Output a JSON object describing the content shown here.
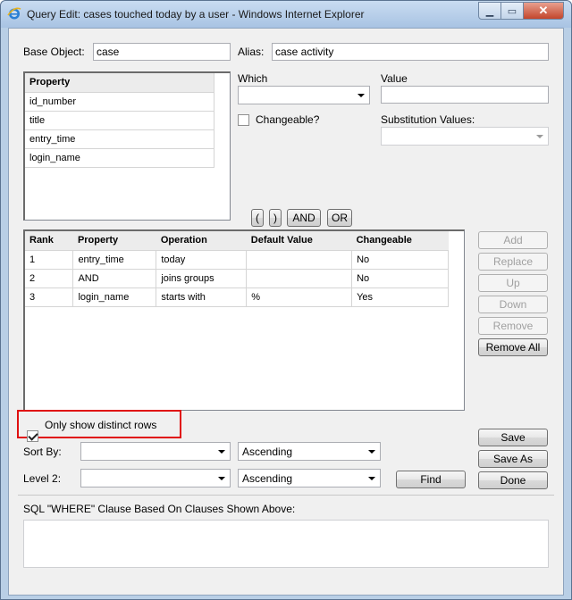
{
  "window": {
    "title": "Query Edit: cases touched today by a user - Windows Internet Explorer",
    "min_glyph": "▁",
    "max_glyph": "▭",
    "close_glyph": "✕"
  },
  "base_object": {
    "label": "Base Object:",
    "value": "case"
  },
  "alias": {
    "label": "Alias:",
    "value": "case activity"
  },
  "property_list": {
    "header": "Property",
    "items": [
      "id_number",
      "title",
      "entry_time",
      "login_name"
    ]
  },
  "which": {
    "label": "Which",
    "value": ""
  },
  "value": {
    "label": "Value",
    "value": ""
  },
  "changeable": {
    "label": "Changeable?",
    "checked": false
  },
  "substitution": {
    "label": "Substitution Values:",
    "value": ""
  },
  "operators": {
    "open_paren": "(",
    "close_paren": ")",
    "and": "AND",
    "or": "OR"
  },
  "clauses": {
    "columns": [
      "Rank",
      "Property",
      "Operation",
      "Default Value",
      "Changeable"
    ],
    "rows": [
      [
        "1",
        "entry_time",
        "today",
        "",
        "No"
      ],
      [
        "2",
        "AND",
        "joins groups",
        "",
        "No"
      ],
      [
        "3",
        "login_name",
        "starts with",
        "%",
        "Yes"
      ]
    ]
  },
  "clause_buttons": {
    "add": "Add",
    "replace": "Replace",
    "up": "Up",
    "down": "Down",
    "remove": "Remove",
    "remove_all": "Remove All"
  },
  "distinct": {
    "label": "Only show distinct rows",
    "checked": true
  },
  "sort_by": {
    "label": "Sort By:",
    "field": "",
    "order": "Ascending"
  },
  "level2": {
    "label": "Level 2:",
    "field": "",
    "order": "Ascending"
  },
  "actions": {
    "find": "Find",
    "save": "Save",
    "save_as": "Save As",
    "done": "Done"
  },
  "sql": {
    "label": "SQL \"WHERE\" Clause Based On Clauses Shown Above:",
    "value": ""
  },
  "colors": {
    "highlight": "#e01010",
    "frame": "#b9cfe6"
  }
}
